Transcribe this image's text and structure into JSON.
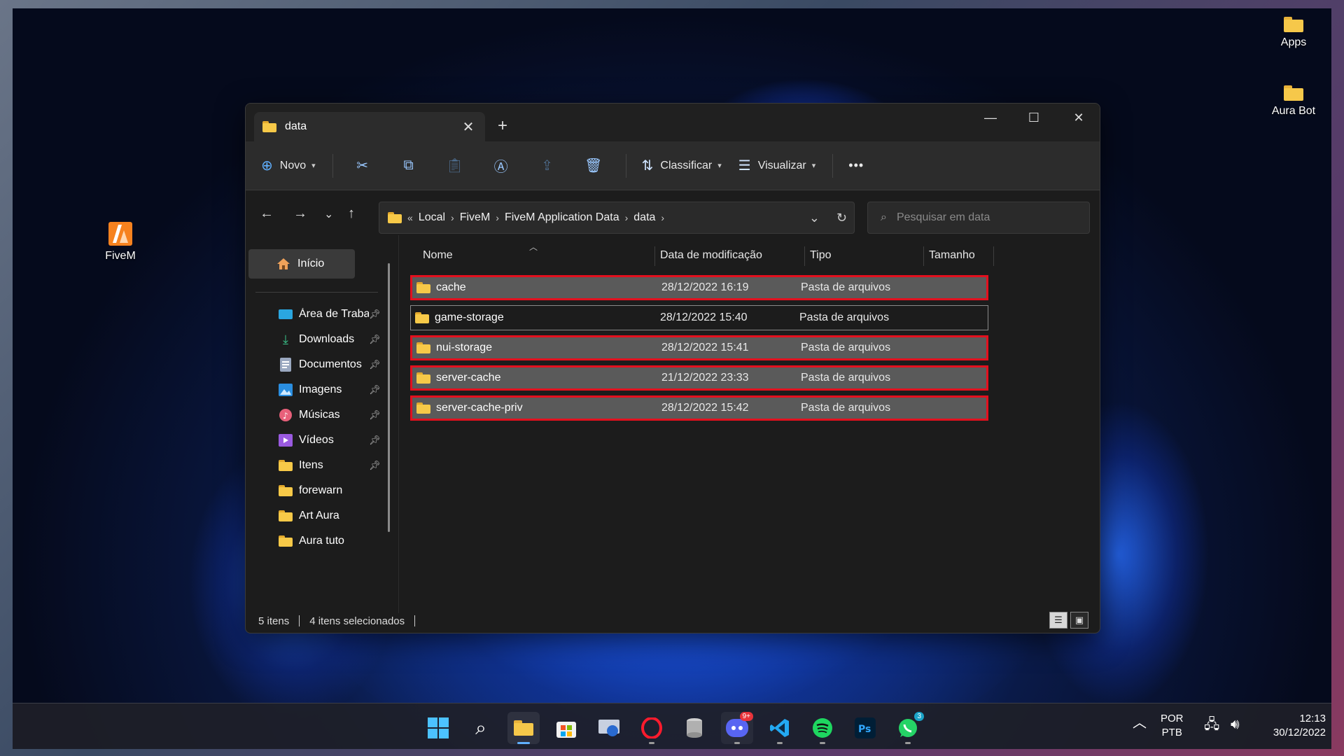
{
  "desktop": {
    "icons": [
      {
        "label": "Apps"
      },
      {
        "label": "Aura Bot"
      },
      {
        "label": "FiveM"
      }
    ]
  },
  "window": {
    "tab_title": "data",
    "toolbar": {
      "new_label": "Novo",
      "sort_label": "Classificar",
      "view_label": "Visualizar",
      "more_label": "•••"
    },
    "address": {
      "overflow": "«",
      "crumbs": [
        "Local",
        "FiveM",
        "FiveM Application Data",
        "data"
      ]
    },
    "search": {
      "placeholder": "Pesquisar em data"
    },
    "sidebar": {
      "home": "Início",
      "items": [
        {
          "label": "Área de Trabalho",
          "icon": "desktop-icon",
          "pinned": true
        },
        {
          "label": "Downloads",
          "icon": "download-icon",
          "pinned": true
        },
        {
          "label": "Documentos",
          "icon": "document-icon",
          "pinned": true
        },
        {
          "label": "Imagens",
          "icon": "image-icon",
          "pinned": true
        },
        {
          "label": "Músicas",
          "icon": "music-icon",
          "pinned": true
        },
        {
          "label": "Vídeos",
          "icon": "video-icon",
          "pinned": true
        },
        {
          "label": "Itens",
          "icon": "folder-icon",
          "pinned": true
        },
        {
          "label": "forewarn",
          "icon": "folder-icon",
          "pinned": false
        },
        {
          "label": "Art Aura",
          "icon": "folder-icon",
          "pinned": false
        },
        {
          "label": "Aura tuto",
          "icon": "folder-icon",
          "pinned": false
        }
      ]
    },
    "columns": {
      "name": "Nome",
      "modified": "Data de modificação",
      "type": "Tipo",
      "size": "Tamanho"
    },
    "files": [
      {
        "name": "cache",
        "modified": "28/12/2022 16:19",
        "type": "Pasta de arquivos",
        "selected": true
      },
      {
        "name": "game-storage",
        "modified": "28/12/2022 15:40",
        "type": "Pasta de arquivos",
        "selected": false
      },
      {
        "name": "nui-storage",
        "modified": "28/12/2022 15:41",
        "type": "Pasta de arquivos",
        "selected": true
      },
      {
        "name": "server-cache",
        "modified": "21/12/2022 23:33",
        "type": "Pasta de arquivos",
        "selected": true
      },
      {
        "name": "server-cache-priv",
        "modified": "28/12/2022 15:42",
        "type": "Pasta de arquivos",
        "selected": true
      }
    ],
    "status": {
      "count": "5 itens",
      "selected": "4 itens selecionados"
    }
  },
  "taskbar": {
    "discord_badge": "9+",
    "whatsapp_badge": "3",
    "lang_top": "POR",
    "lang_bottom": "PTB",
    "time": "12:13",
    "date": "30/12/2022",
    "accent": "#60b0ff"
  }
}
